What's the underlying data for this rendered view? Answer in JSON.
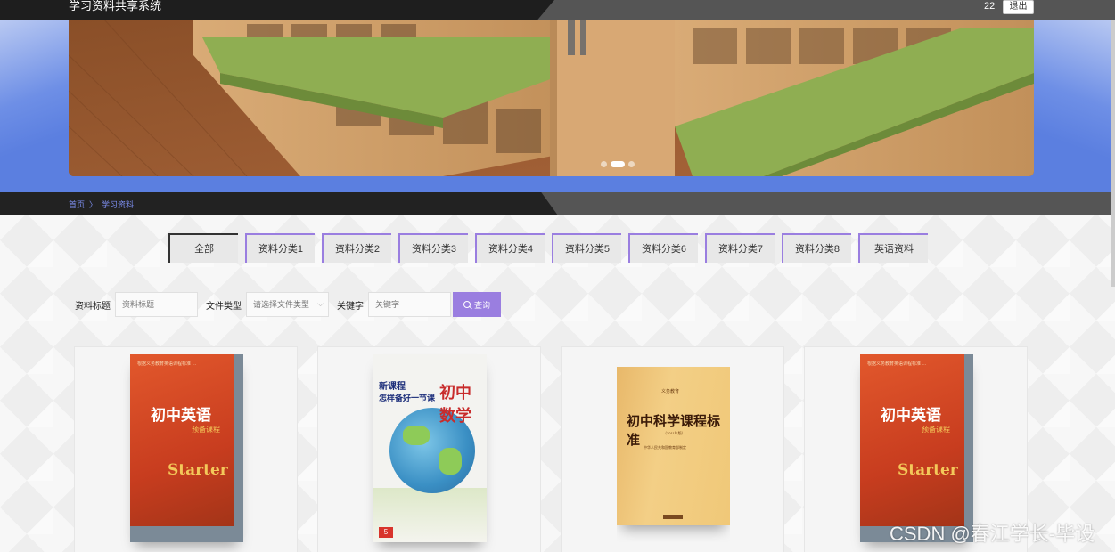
{
  "header": {
    "site_title": "学习资料共享系统",
    "user_name": "22",
    "logout_label": "退出"
  },
  "banner": {
    "slides": 3,
    "active_slide": 2
  },
  "breadcrumb": {
    "home": "首页",
    "separator": "〉",
    "current": "学习资料"
  },
  "tabs": [
    {
      "label": "全部",
      "active": true
    },
    {
      "label": "资料分类1"
    },
    {
      "label": "资料分类2"
    },
    {
      "label": "资料分类3"
    },
    {
      "label": "资料分类4"
    },
    {
      "label": "资料分类5"
    },
    {
      "label": "资料分类6"
    },
    {
      "label": "资料分类7"
    },
    {
      "label": "资料分类8"
    },
    {
      "label": "英语资料"
    }
  ],
  "search": {
    "title_label": "资料标题",
    "title_placeholder": "资料标题",
    "type_label": "文件类型",
    "type_placeholder": "请选择文件类型",
    "keyword_label": "关键字",
    "keyword_placeholder": "关键字",
    "button_label": "查询"
  },
  "cards": [
    {
      "cover": {
        "line1": "根据义务教育英语课程标准 …",
        "title": "初中英语",
        "sub": "预备课程",
        "word": "Starter"
      }
    },
    {
      "cover": {
        "line1": "新课程",
        "line2": "怎样备好一节课",
        "title": "初中数学",
        "badge": "5"
      }
    },
    {
      "cover": {
        "line1": "义务教育",
        "title": "初中科学课程标准",
        "line2": "（2011年版）",
        "line3": "中华人民共和国教育部制定"
      }
    },
    {
      "cover": {
        "line1": "根据义务教育英语课程标准 …",
        "title": "初中英语",
        "sub": "预备课程",
        "word": "Starter"
      }
    }
  ],
  "watermark": "CSDN @春江学长-毕设",
  "colors": {
    "accent": "#9a7ee0",
    "banner_blue": "#5b7fe0",
    "header_dark": "#1e1e1e",
    "link": "#7d8ff0"
  }
}
